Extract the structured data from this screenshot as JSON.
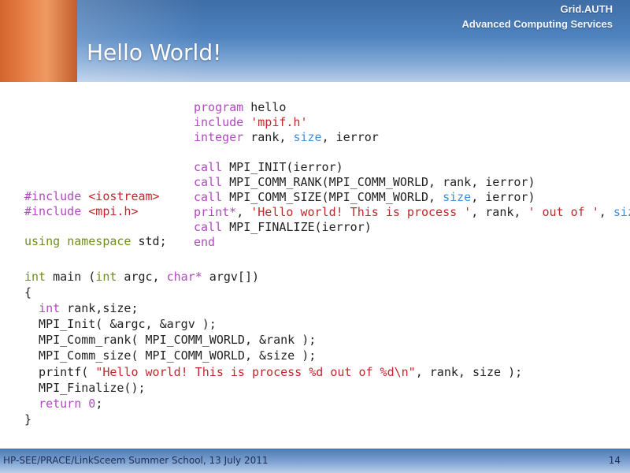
{
  "header": {
    "brand_line1": "Grid.AUTH",
    "brand_line2": "Advanced Computing Services",
    "title": "Hello World!",
    "accent_colors": [
      "#d2652d",
      "#4f83bf"
    ]
  },
  "code": {
    "fortran": {
      "l1_kw": "program",
      "l1_rest": " hello",
      "l2_kw": "include",
      "l2_str": " 'mpif.h'",
      "l3_kw": "integer",
      "l3_a": " rank, ",
      "l3_typ": "size",
      "l3_b": ", ierror",
      "l5_kw": "call",
      "l5_rest": " MPI_INIT(ierror)",
      "l6_kw": "call",
      "l6_rest": " MPI_COMM_RANK(MPI_COMM_WORLD, rank, ierror)",
      "l7_kw": "call",
      "l7_a": " MPI_COMM_SIZE(MPI_COMM_WORLD, ",
      "l7_typ": "size",
      "l7_b": ", ierror)",
      "l8_kw": "print*",
      "l8_a": ", ",
      "l8_str1": "'Hello world! This is process '",
      "l8_b": ", rank, ",
      "l8_str2": "' out of '",
      "l8_c": ", ",
      "l8_typ": "size",
      "l9_kw": "call",
      "l9_rest": " MPI_FINALIZE(ierror)",
      "l10_kw": "end"
    },
    "cpp_includes": {
      "l1_kw": "#include",
      "l1_str": " <iostream>",
      "l2_kw": "#include",
      "l2_str": " <mpi.h>",
      "l4_grn1": "using",
      "l4_sp": " ",
      "l4_grn2": "namespace",
      "l4_rest": " std;"
    },
    "cpp_main": {
      "l1_kw1": "int",
      "l1_a": " main (",
      "l1_kw2": "int",
      "l1_b": " argc, ",
      "l1_kw3": "char*",
      "l1_c": " argv[])",
      "l2": "{",
      "l3_ind": "  ",
      "l3_kw": "int",
      "l3_rest": " rank,size;",
      "l4": "  MPI_Init( &argc, &argv );",
      "l5": "  MPI_Comm_rank( MPI_COMM_WORLD, &rank );",
      "l6": "  MPI_Comm_size( MPI_COMM_WORLD, &size );",
      "l7_a": "  printf( ",
      "l7_str": "\"Hello world! This is process %d out of %d\\n\"",
      "l7_b": ", rank, size );",
      "l8": "  MPI_Finalize();",
      "l9_ind": "  ",
      "l9_kw": "return",
      "l9_sp": " ",
      "l9_num": "0",
      "l9_end": ";",
      "l10": "}"
    }
  },
  "footer": {
    "text": "HP-SEE/PRACE/LinkSceem Summer School, 13 July 2011",
    "page_number": "14"
  }
}
